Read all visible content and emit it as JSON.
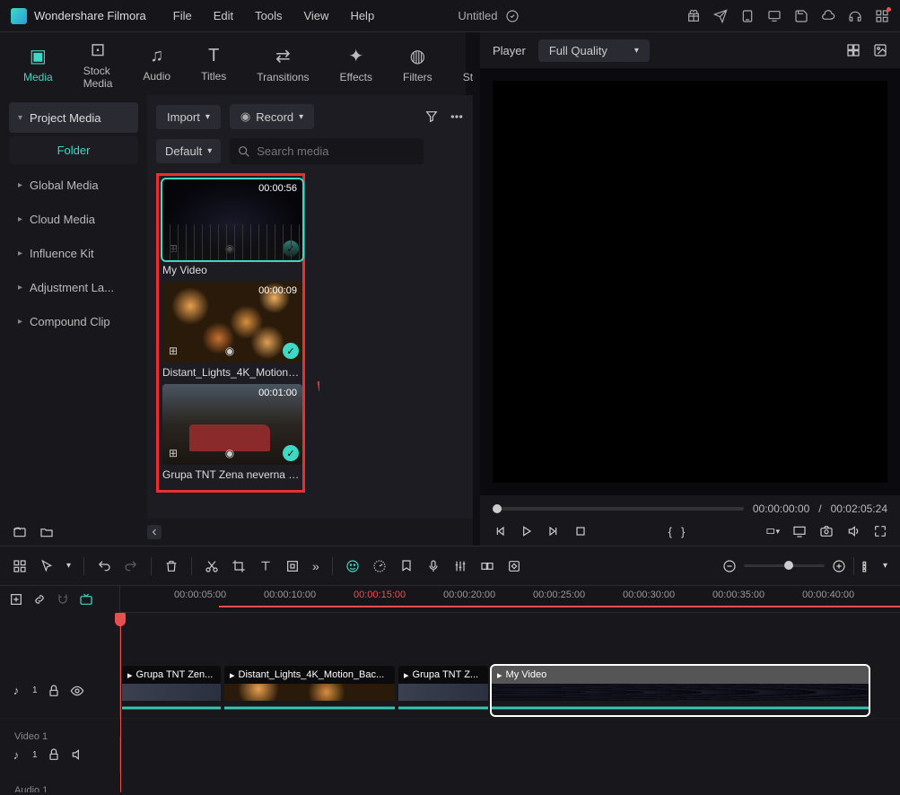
{
  "app": {
    "title": "Wondershare Filmora",
    "project": "Untitled"
  },
  "menu": {
    "file": "File",
    "edit": "Edit",
    "tools": "Tools",
    "view": "View",
    "help": "Help"
  },
  "tabs": {
    "media": "Media",
    "stock": "Stock Media",
    "audio": "Audio",
    "titles": "Titles",
    "transitions": "Transitions",
    "effects": "Effects",
    "filters": "Filters",
    "stickers": "Stickers"
  },
  "sidebar": {
    "project": "Project Media",
    "folder": "Folder",
    "global": "Global Media",
    "cloud": "Cloud Media",
    "influence": "Influence Kit",
    "adjustment": "Adjustment La...",
    "compound": "Compound Clip"
  },
  "mid": {
    "import": "Import",
    "record": "Record",
    "sort": "Default",
    "search_ph": "Search media"
  },
  "clips": [
    {
      "name": "My Video",
      "dur": "00:00:56"
    },
    {
      "name": "Distant_Lights_4K_Motion_B...",
      "dur": "00:00:09"
    },
    {
      "name": "Grupa TNT Zena neverna off...",
      "dur": "00:01:00"
    }
  ],
  "preview": {
    "player": "Player",
    "quality": "Full Quality",
    "current": "00:00:00:00",
    "sep": "/",
    "total": "00:02:05:24"
  },
  "ruler": [
    "00:00:05:00",
    "00:00:10:00",
    "00:00:15:00",
    "00:00:20:00",
    "00:00:25:00",
    "00:00:30:00",
    "00:00:35:00",
    "00:00:40:00"
  ],
  "tracks": {
    "video": "Video 1",
    "audio": "Audio 1"
  },
  "timeline_clips": {
    "c1": "Grupa TNT Zen...",
    "c2": "Distant_Lights_4K_Motion_Bac...",
    "c3": "Grupa TNT Z...",
    "c4": "My Video"
  }
}
